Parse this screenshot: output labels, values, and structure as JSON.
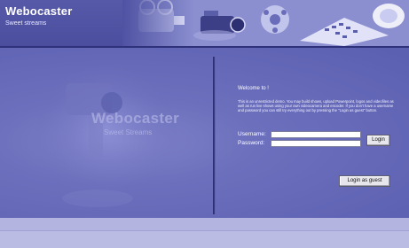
{
  "brand": {
    "title": "Webocaster",
    "tagline": "Sweet streams"
  },
  "header": {
    "collage_icons": [
      "cinema-projector-icon",
      "video-camera-icon",
      "film-reel-icon",
      "keyboard-icon",
      "satellite-dish-icon"
    ]
  },
  "watermark": {
    "title": "Webocaster",
    "subtitle": "Sweet Streams",
    "icon": "video-camera-icon"
  },
  "login": {
    "welcome": "Welcome to !",
    "intro": "This is an unrestricted demo. You may build shows, upload Powerpoint, logos and videofiles as well as run live shows using your own videocamera and encoder. If you don't have a username and password you can still try everything out by pressing the \"Login as guest\" button.",
    "username_label": "Username:",
    "password_label": "Password:",
    "username_value": "",
    "password_value": "",
    "login_button": "Login",
    "guest_button": "Login as guest"
  },
  "colors": {
    "header": "#4f52a2",
    "panel": "#6266b4",
    "background": "#b7b8e1",
    "text": "#ffffff"
  }
}
